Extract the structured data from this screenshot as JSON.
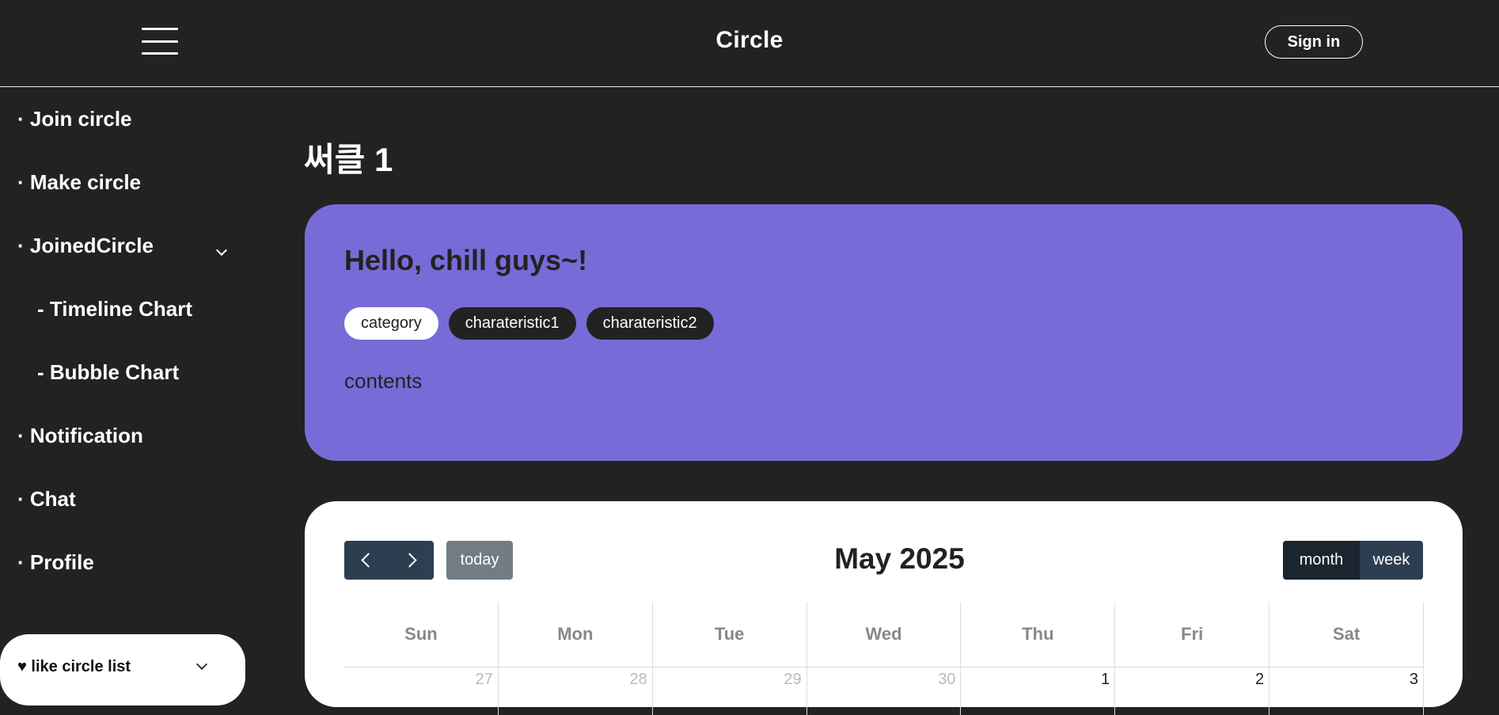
{
  "header": {
    "title": "Circle",
    "signin_label": "Sign in"
  },
  "sidebar": {
    "items": [
      {
        "label": "· Join circle"
      },
      {
        "label": "· Make circle"
      },
      {
        "label": "· JoinedCircle"
      },
      {
        "label": "- Timeline Chart"
      },
      {
        "label": "- Bubble Chart"
      },
      {
        "label": "· Notification"
      },
      {
        "label": "· Chat"
      },
      {
        "label": "· Profile"
      }
    ],
    "like_panel": {
      "label": "♥ like circle list"
    }
  },
  "main": {
    "heading": "써클 1",
    "intro": {
      "title": "Hello, chill guys~!",
      "tags": [
        "category",
        "charateristic1",
        "charateristic2"
      ],
      "contents": "contents"
    },
    "calendar": {
      "title": "May 2025",
      "today_label": "today",
      "view_month_label": "month",
      "view_week_label": "week",
      "day_headers": [
        "Sun",
        "Mon",
        "Tue",
        "Wed",
        "Thu",
        "Fri",
        "Sat"
      ],
      "first_week": [
        "27",
        "28",
        "29",
        "30",
        "1",
        "2",
        "3"
      ]
    }
  },
  "colors": {
    "background": "#222222",
    "intro_card": "#786bd7",
    "nav_button": "#2c3e50",
    "today_button": "#6c757d"
  }
}
